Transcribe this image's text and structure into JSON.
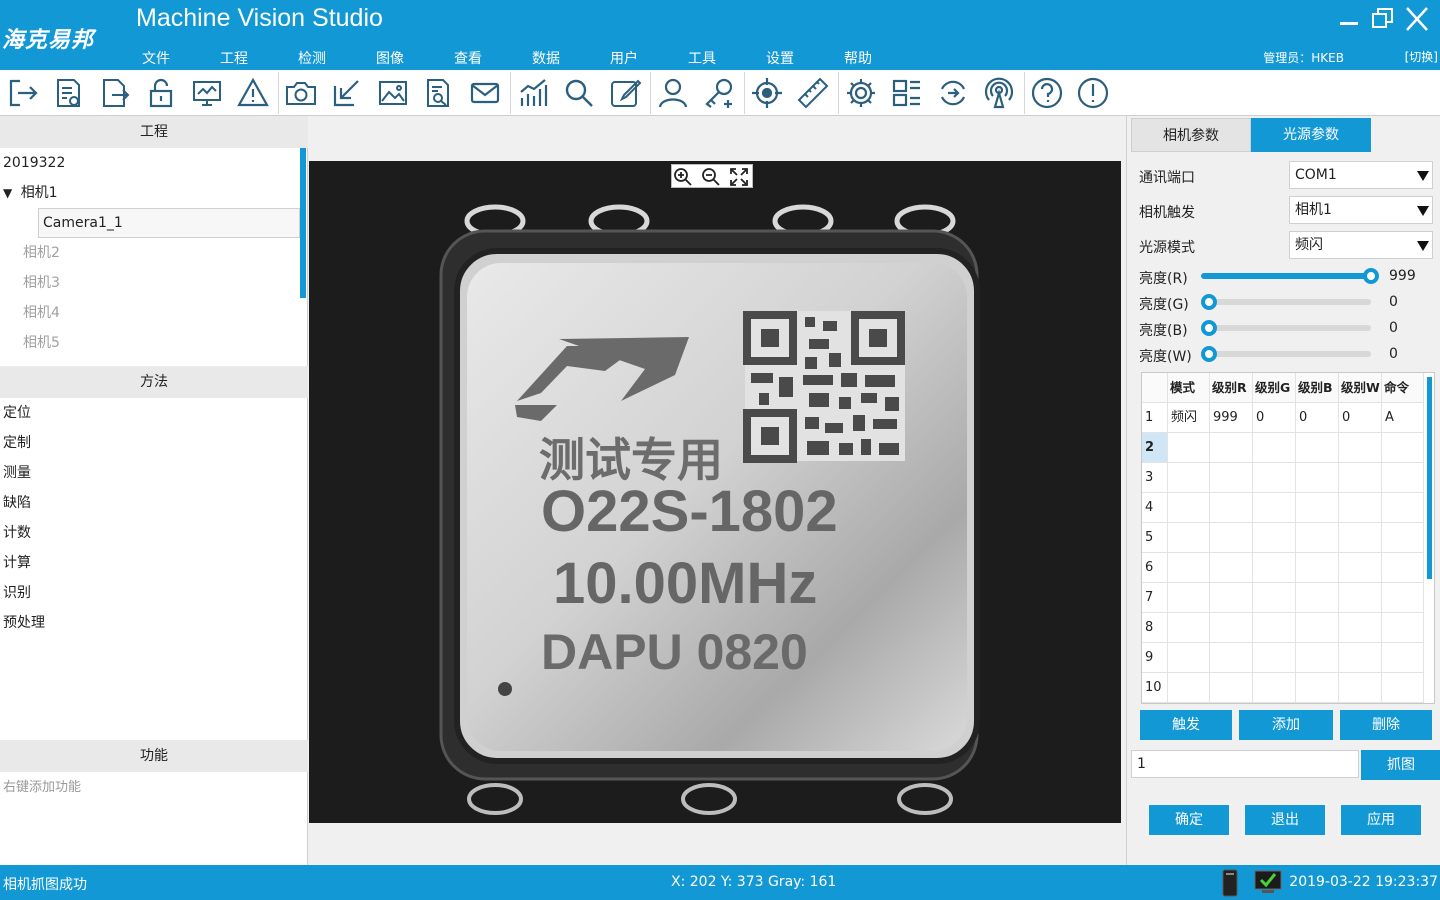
{
  "header": {
    "logo": "海克易邦",
    "title": "Machine Vision Studio",
    "menus": [
      "文件",
      "工程",
      "检测",
      "图像",
      "查看",
      "数据",
      "用户",
      "工具",
      "设置",
      "帮助"
    ],
    "user_info": "管理员：HKEB",
    "switch_label": "[切换]"
  },
  "toolbar": {
    "icons": [
      "exit-icon",
      "report-icon",
      "export-icon",
      "lock-icon",
      "monitor-icon",
      "warning-icon",
      "camera-icon",
      "import-icon",
      "image-icon",
      "document-search-icon",
      "mail-icon",
      "chart-icon",
      "search-icon",
      "edit-icon",
      "user-icon",
      "key-add-icon",
      "target-icon",
      "ruler-icon",
      "gear-icon",
      "layout-icon",
      "sync-icon",
      "signal-icon",
      "help-icon",
      "info-icon"
    ]
  },
  "left": {
    "project_header": "工程",
    "project": "2019322",
    "camera_group": "相机1",
    "camera_selected": "Camera1_1",
    "cameras_other": [
      "相机2",
      "相机3",
      "相机4",
      "相机5"
    ],
    "method_header": "方法",
    "methods": [
      "定位",
      "定制",
      "测量",
      "缺陷",
      "计数",
      "计算",
      "识别",
      "预处理"
    ],
    "function_header": "功能",
    "function_hint": "右键添加功能"
  },
  "image": {
    "chinese_text": "测试专用",
    "part_number": "O22S-1802",
    "frequency": "10.00MHz",
    "maker": "DAPU 0820"
  },
  "right": {
    "tabs": [
      "相机参数",
      "光源参数"
    ],
    "active_tab": "光源参数",
    "port_label": "通讯端口",
    "port_value": "COM1",
    "trigger_label": "相机触发",
    "trigger_value": "相机1",
    "mode_label": "光源模式",
    "mode_value": "频闪",
    "brightness": [
      {
        "label": "亮度(R)",
        "value": "999",
        "fraction": 1.0
      },
      {
        "label": "亮度(G)",
        "value": "0",
        "fraction": 0.0
      },
      {
        "label": "亮度(B)",
        "value": "0",
        "fraction": 0.0
      },
      {
        "label": "亮度(W)",
        "value": "0",
        "fraction": 0.0
      }
    ],
    "table": {
      "headers": [
        "模式",
        "级别R",
        "级别G",
        "级别B",
        "级别W",
        "命令"
      ],
      "rows": [
        {
          "index": "1",
          "cells": [
            "频闪",
            "999",
            "0",
            "0",
            "0",
            "A"
          ]
        },
        {
          "index": "2",
          "cells": [
            "",
            "",
            "",
            "",
            "",
            ""
          ]
        },
        {
          "index": "3",
          "cells": [
            "",
            "",
            "",
            "",
            "",
            ""
          ]
        },
        {
          "index": "4",
          "cells": [
            "",
            "",
            "",
            "",
            "",
            ""
          ]
        },
        {
          "index": "5",
          "cells": [
            "",
            "",
            "",
            "",
            "",
            ""
          ]
        },
        {
          "index": "6",
          "cells": [
            "",
            "",
            "",
            "",
            "",
            ""
          ]
        },
        {
          "index": "7",
          "cells": [
            "",
            "",
            "",
            "",
            "",
            ""
          ]
        },
        {
          "index": "8",
          "cells": [
            "",
            "",
            "",
            "",
            "",
            ""
          ]
        },
        {
          "index": "9",
          "cells": [
            "",
            "",
            "",
            "",
            "",
            ""
          ]
        },
        {
          "index": "10",
          "cells": [
            "",
            "",
            "",
            "",
            "",
            ""
          ]
        }
      ],
      "selected_row": "2"
    },
    "trigger_button": "触发",
    "add_button": "添加",
    "delete_button": "删除",
    "capture_input_value": "1",
    "capture_button": "抓图",
    "ok_button": "确定",
    "exit_button": "退出",
    "apply_button": "应用"
  },
  "status": {
    "message": "相机抓图成功",
    "coords": "X: 202 Y: 373   Gray: 161",
    "datetime": "2019-03-22 19:23:37"
  },
  "colors": {
    "accent": "#1398d6",
    "panel_bg": "#f0f0f0",
    "image_bg": "#1c1c1c"
  }
}
